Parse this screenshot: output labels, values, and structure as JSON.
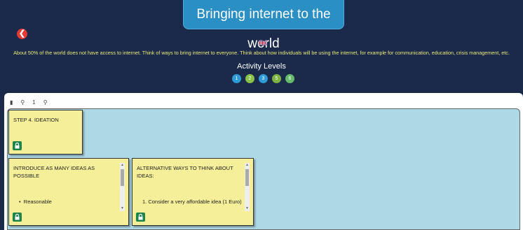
{
  "header": {
    "title": "Bringing internet to the world",
    "back_icon": "arrow-left-icon",
    "flag_icon": "uk-flag-icon",
    "description": "About 50% of the world does not have access to internet. Think of ways to bring internet to everyone. Think about how individuals will be using the internet, for example for communication, education, crisis management, etc."
  },
  "activity_levels": {
    "title": "Activity Levels",
    "levels": [
      {
        "label": "1",
        "color": "#2e9bd6"
      },
      {
        "label": "2",
        "color": "#8bc34a"
      },
      {
        "label": "3",
        "color": "#2e9bd6"
      },
      {
        "label": "5",
        "color": "#7cb342"
      },
      {
        "label": "6",
        "color": "#66bb6a"
      }
    ]
  },
  "toolbar": {
    "menu_icon": "menu-icon",
    "zoom_out_icon": "zoom-out-icon",
    "zoom_level": "1",
    "zoom_in_icon": "zoom-in-icon"
  },
  "notes": [
    {
      "title": "STEP 4. IDEATION",
      "lock_icon": "lock-icon"
    },
    {
      "title": "INTRODUCE AS MANY IDEAS AS POSSIBLE",
      "item": "Reasonable",
      "lock_icon": "lock-icon"
    },
    {
      "title": "ALTERNATIVE WAYS TO THINK ABOUT IDEAS:",
      "item": "1. Consider a very affordable idea (1 Euro)",
      "lock_icon": "lock-icon"
    }
  ],
  "colors": {
    "header_bg": "#1b2a4a",
    "title_bg": "#2a8fc4",
    "board_bg": "#add8e6",
    "note_bg": "#f5ef9a",
    "lock_bg": "#1e8449",
    "back_button": "#e53935"
  }
}
